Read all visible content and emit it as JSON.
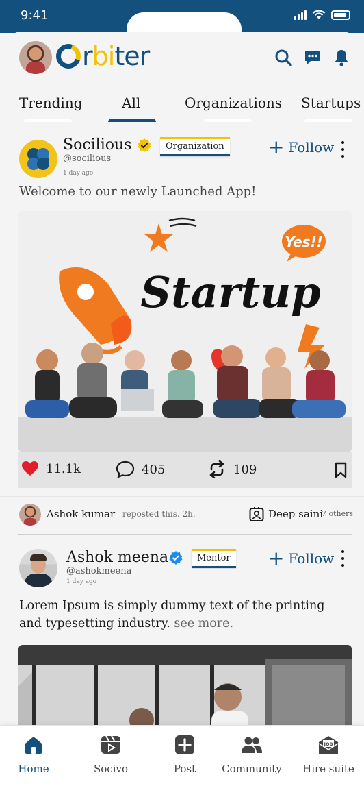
{
  "status_bar": {
    "time": "9:41"
  },
  "header": {
    "logo": {
      "o": "O",
      "part1": "r",
      "part2": "bi",
      "part3": "ter"
    },
    "icons": [
      "search-icon",
      "chat-icon",
      "bell-icon"
    ]
  },
  "tabs": [
    {
      "label": "Trending",
      "active": false
    },
    {
      "label": "All",
      "active": true
    },
    {
      "label": "Organizations",
      "active": false
    },
    {
      "label": "Startups",
      "active": false
    }
  ],
  "post1": {
    "name": "Socilious",
    "handle": "@socilious",
    "time_ago": "1 day ago",
    "badge": "Organization",
    "follow_label": "Follow",
    "caption": "Welcome to our newly Launched App!",
    "image": {
      "headline": "Startup",
      "speech": "Yes!!"
    },
    "likes": "11.1k",
    "comments": "405",
    "reposts": "109"
  },
  "repost": {
    "user": "Ashok kumar",
    "action": "reposted this. 2h.",
    "other_user": "Deep saini",
    "others": "7 others"
  },
  "post2": {
    "name": "Ashok meena",
    "handle": "@ashokmeena",
    "time_ago": "1 day ago",
    "badge": "Mentor",
    "follow_label": "Follow",
    "body": "Lorem Ipsum is simply dummy text of the printing and typesetting industry.",
    "see_more": "see more."
  },
  "bottom_nav": [
    {
      "label": "Home",
      "icon": "home-icon",
      "active": true
    },
    {
      "label": "Socivo",
      "icon": "video-icon",
      "active": false
    },
    {
      "label": "Post",
      "icon": "plus-square-icon",
      "active": false
    },
    {
      "label": "Community",
      "icon": "people-icon",
      "active": false
    },
    {
      "label": "Hire suite",
      "icon": "job-icon",
      "active": false
    }
  ],
  "colors": {
    "brand_blue": "#14507e",
    "brand_yellow": "#f2c300",
    "like_red": "#e11d2a",
    "verified_blue": "#1d8cf0",
    "verified_gold": "#f2c300"
  }
}
